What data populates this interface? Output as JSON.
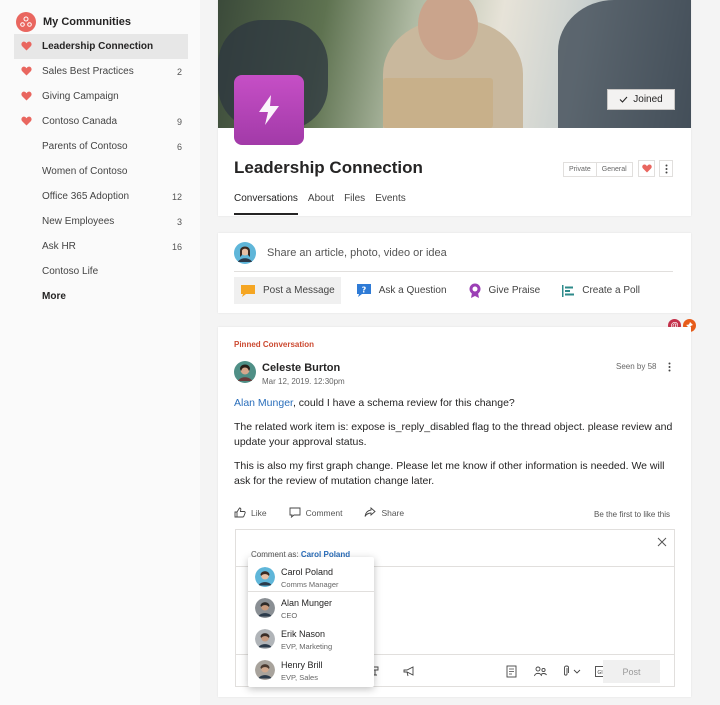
{
  "sidebar": {
    "header": "My Communities",
    "items": [
      {
        "label": "Leadership Connection",
        "count": "",
        "favorite": true,
        "active": true
      },
      {
        "label": "Sales Best Practices",
        "count": "2",
        "favorite": true
      },
      {
        "label": "Giving Campaign",
        "count": "",
        "favorite": true
      },
      {
        "label": "Contoso Canada",
        "count": "9",
        "favorite": true
      },
      {
        "label": "Parents of Contoso",
        "count": "6",
        "favorite": false
      },
      {
        "label": "Women of Contoso",
        "count": "",
        "favorite": false
      },
      {
        "label": "Office 365 Adoption",
        "count": "12",
        "favorite": false
      },
      {
        "label": "New Employees",
        "count": "3",
        "favorite": false
      },
      {
        "label": "Ask HR",
        "count": "16",
        "favorite": false
      },
      {
        "label": "Contoso Life",
        "count": "",
        "favorite": false
      }
    ],
    "more": "More"
  },
  "community": {
    "joined_label": "Joined",
    "title": "Leadership Connection",
    "privacy": "Private",
    "classification": "General",
    "tabs": [
      "Conversations",
      "About",
      "Files",
      "Events"
    ]
  },
  "publisher": {
    "placeholder": "Share an article, photo, video or idea",
    "actions": [
      "Post a Message",
      "Ask a Question",
      "Give Praise",
      "Create a Poll"
    ]
  },
  "conversation": {
    "pinned_label": "Pinned Conversation",
    "author": "Celeste Burton",
    "date": "Mar 12, 2019. 12:30pm",
    "seen": "Seen by 58",
    "mention": "Alan Munger",
    "line1_rest": ", could I have a schema review for this change?",
    "para2": "The related work item is: expose is_reply_disabled flag to the thread object. please review and update your approval status.",
    "para3": "This is also my first graph change. Please let me know if other information is needed. We will ask for the review of mutation change later.",
    "like": "Like",
    "comment": "Comment",
    "share": "Share",
    "first_like": "Be the first to like this"
  },
  "comment_box": {
    "comment_as_label": "Comment as:",
    "comment_as_user": "Carol Poland",
    "post_label": "Post"
  },
  "mention_suggestions": [
    {
      "name": "Carol Poland",
      "role": "Comms Manager"
    },
    {
      "name": "Alan Munger",
      "role": "CEO"
    },
    {
      "name": "Erik Nason",
      "role": "EVP, Marketing"
    },
    {
      "name": "Henry Brill",
      "role": "EVP, Sales"
    }
  ],
  "colors": {
    "accent_red": "#e9665f",
    "link_blue": "#2a6ebb",
    "pinned_orange": "#cc4a31",
    "app_purple": "#b445b7"
  }
}
